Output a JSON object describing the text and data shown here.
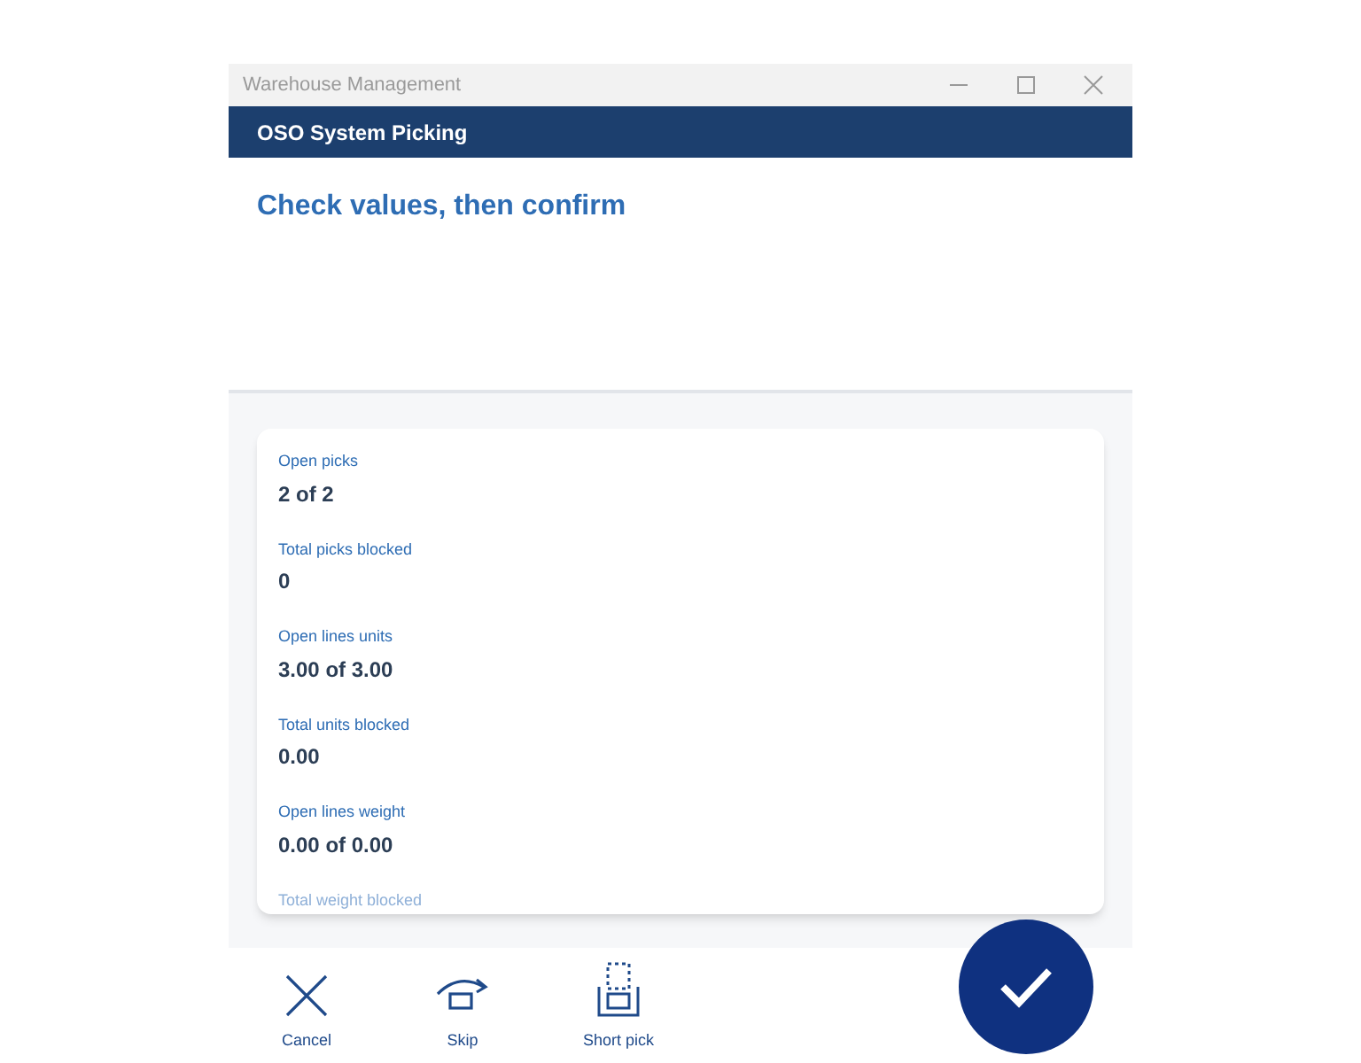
{
  "window": {
    "title": "Warehouse Management"
  },
  "header": {
    "title": "OSO System Picking"
  },
  "instruction": "Check values, then confirm",
  "fields": [
    {
      "label": "Open picks",
      "value": "2 of 2"
    },
    {
      "label": "Total picks blocked",
      "value": "0"
    },
    {
      "label": "Open lines units",
      "value": "3.00 of 3.00"
    },
    {
      "label": "Total units blocked",
      "value": "0.00"
    },
    {
      "label": "Open lines weight",
      "value": "0.00 of 0.00"
    },
    {
      "label": "Total weight blocked"
    }
  ],
  "actions": [
    {
      "kind": "cancel",
      "label": "Cancel"
    },
    {
      "kind": "skip",
      "label": "Skip"
    },
    {
      "kind": "short",
      "label": "Short pick"
    }
  ]
}
